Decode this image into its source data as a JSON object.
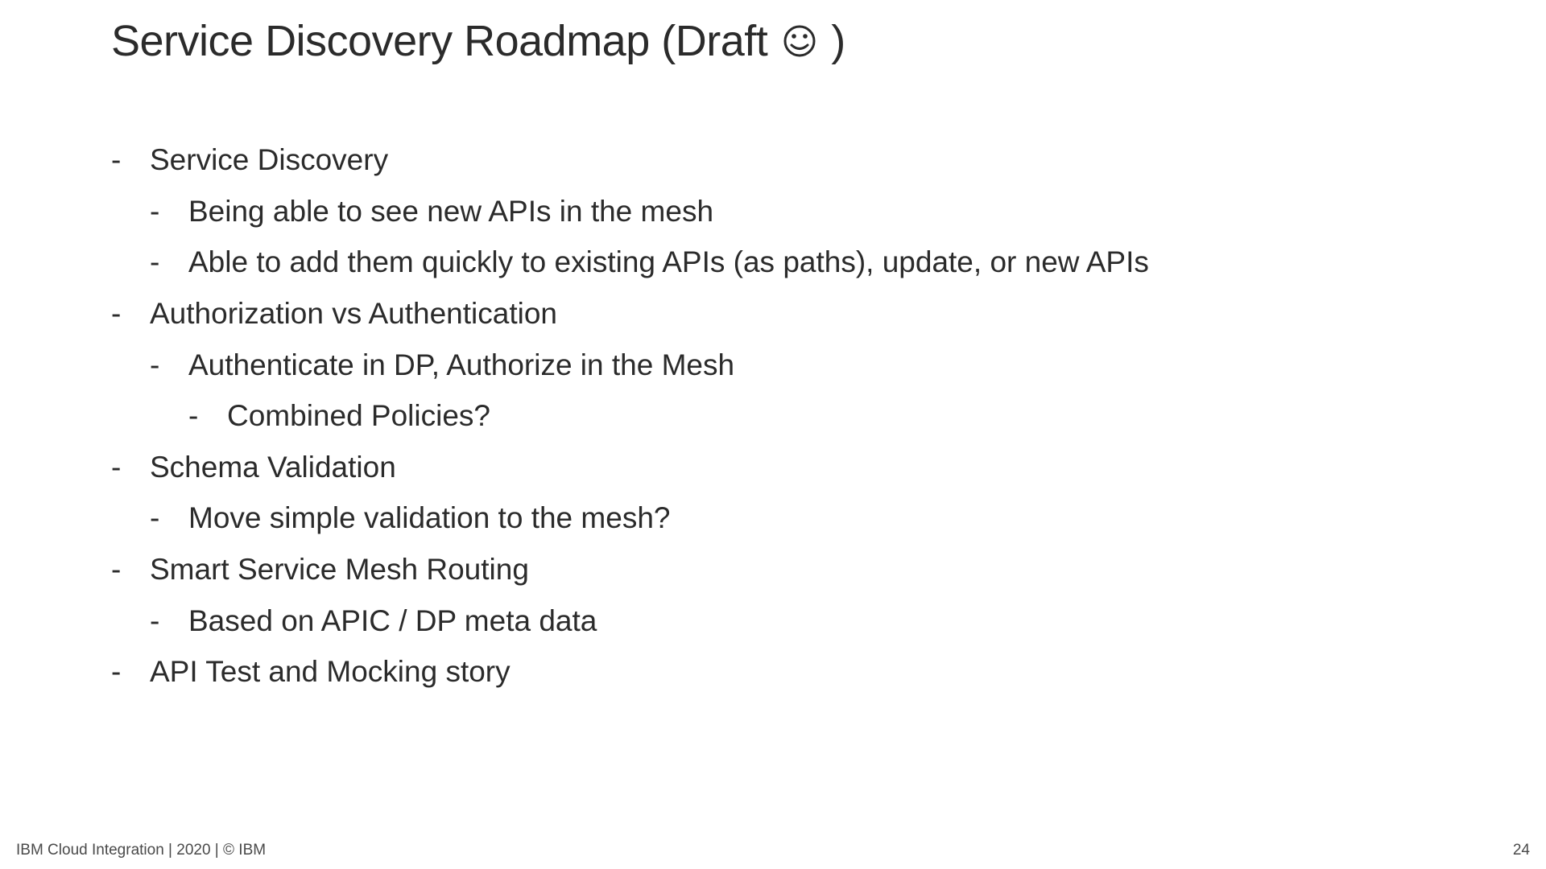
{
  "title_part1": "Service Discovery Roadmap (Draft ",
  "title_part2": " )",
  "bullets": {
    "b1": "Service Discovery",
    "b1_1": "Being able to see new APIs in the mesh",
    "b1_2": "Able to add them quickly to existing APIs (as paths), update, or new APIs",
    "b2": "Authorization vs Authentication",
    "b2_1": "Authenticate in DP, Authorize in the Mesh",
    "b2_1_1": "Combined Policies?",
    "b3": "Schema Validation",
    "b3_1": "Move simple validation to the mesh?",
    "b4": "Smart Service Mesh Routing",
    "b4_1": "Based on APIC / DP meta data",
    "b5": "API Test and Mocking story"
  },
  "footer": {
    "left": "IBM Cloud Integration  | 2020 | © IBM",
    "right": "24"
  }
}
